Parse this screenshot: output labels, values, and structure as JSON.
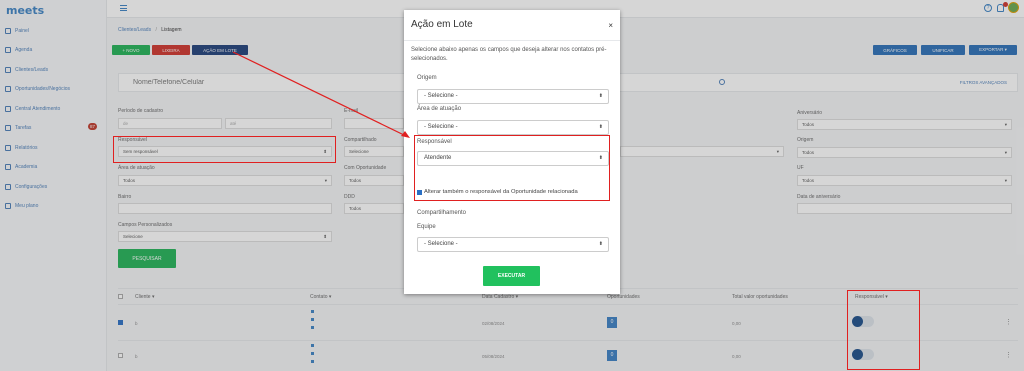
{
  "app": {
    "logo": "meets"
  },
  "sidebar": {
    "items": [
      {
        "label": "Painel",
        "icon": "home-icon"
      },
      {
        "label": "Agenda",
        "icon": "calendar-icon"
      },
      {
        "label": "Clientes/Leads",
        "icon": "users-icon"
      },
      {
        "label": "Oportunidades/Negócios",
        "icon": "briefcase-icon"
      },
      {
        "label": "Central Atendimento",
        "icon": "headset-icon"
      },
      {
        "label": "Tarefas",
        "icon": "tasks-icon",
        "badge": "87"
      },
      {
        "label": "Relatórios",
        "icon": "chart-icon"
      },
      {
        "label": "Academia",
        "icon": "academy-icon"
      },
      {
        "label": "Configurações",
        "icon": "gear-icon"
      },
      {
        "label": "Meu plano",
        "icon": "card-icon"
      }
    ]
  },
  "breadcrumb": {
    "parent": "Clientes/Leads",
    "sep": "/",
    "current": "Listagem"
  },
  "toolbar": {
    "novo": "+ NOVO",
    "lixeira": "LIXEIRA",
    "acao_em_lote": "AÇÃO EM LOTE",
    "graficos": "GRÁFICOS",
    "unificar": "UNIFICAR",
    "exportar": "EXPORTAR ▾"
  },
  "search": {
    "placeholder": "Nome/Telefone/Celular",
    "advanced": "FILTROS AVANÇADOS"
  },
  "filters": {
    "periodo_label": "Período de cadastro",
    "de_placeholder": "de",
    "ate_placeholder": "até",
    "email_label": "E-mail",
    "responsavel_label": "Responsável",
    "responsavel_value": "Sem responsável",
    "compartilhado_label": "Compartilhado",
    "compartilhado_value": "Selecione",
    "area_label": "Área de atuação",
    "area_value": "Todos",
    "com_oportunidade_label": "Com Oportunidade",
    "com_oportunidade_value": "Todos",
    "bairro_label": "Bairro",
    "ddd_label": "DDD",
    "ddd_value": "Todos",
    "campos_label": "Campos Personalizados",
    "campos_value": "Selecione",
    "aniversario_label": "Aniversário",
    "aniversario_value": "Todos",
    "origem_label": "Origem",
    "origem_value": "Todos",
    "uf_label": "UF",
    "uf_value": "Todos",
    "data_aniversario_label": "Data de aniversário",
    "pesquisar": "PESQUISAR"
  },
  "table": {
    "headers": {
      "cliente": "Cliente ▾",
      "contato": "Contato ▾",
      "data_cadastro": "Data Cadastro ▾",
      "oportunidades": "Oportunidades",
      "total": "Total valor oportunidades",
      "responsavel": "Responsável ▾"
    },
    "rows": [
      {
        "cliente": "b",
        "data": "02/08/2024",
        "oportunidades": "0",
        "total": "0,00"
      },
      {
        "cliente": "b",
        "data": "05/08/2024",
        "oportunidades": "0",
        "total": "0,00"
      }
    ]
  },
  "modal": {
    "title": "Ação em Lote",
    "close": "×",
    "description": "Selecione abaixo apenas os campos que deseja alterar nos contatos pré-selecionados.",
    "origem_label": "Origem",
    "origem_value": "- Selecione -",
    "area_label": "Área de atuação",
    "area_value": "- Selecione -",
    "responsavel_label": "Responsável",
    "responsavel_value": "Atendente",
    "alterar_label": "Alterar também o responsável da Oportunidade relacionada",
    "compartilhamento_label": "Compartilhamento",
    "equipe_label": "Equipe",
    "equipe_value": "- Selecione -",
    "executar": "EXECUTAR"
  },
  "colors": {
    "brand": "#3b82c4",
    "green": "#21b356",
    "red": "#d0342c",
    "navy": "#1e3f7a",
    "annotation": "#e02020"
  }
}
